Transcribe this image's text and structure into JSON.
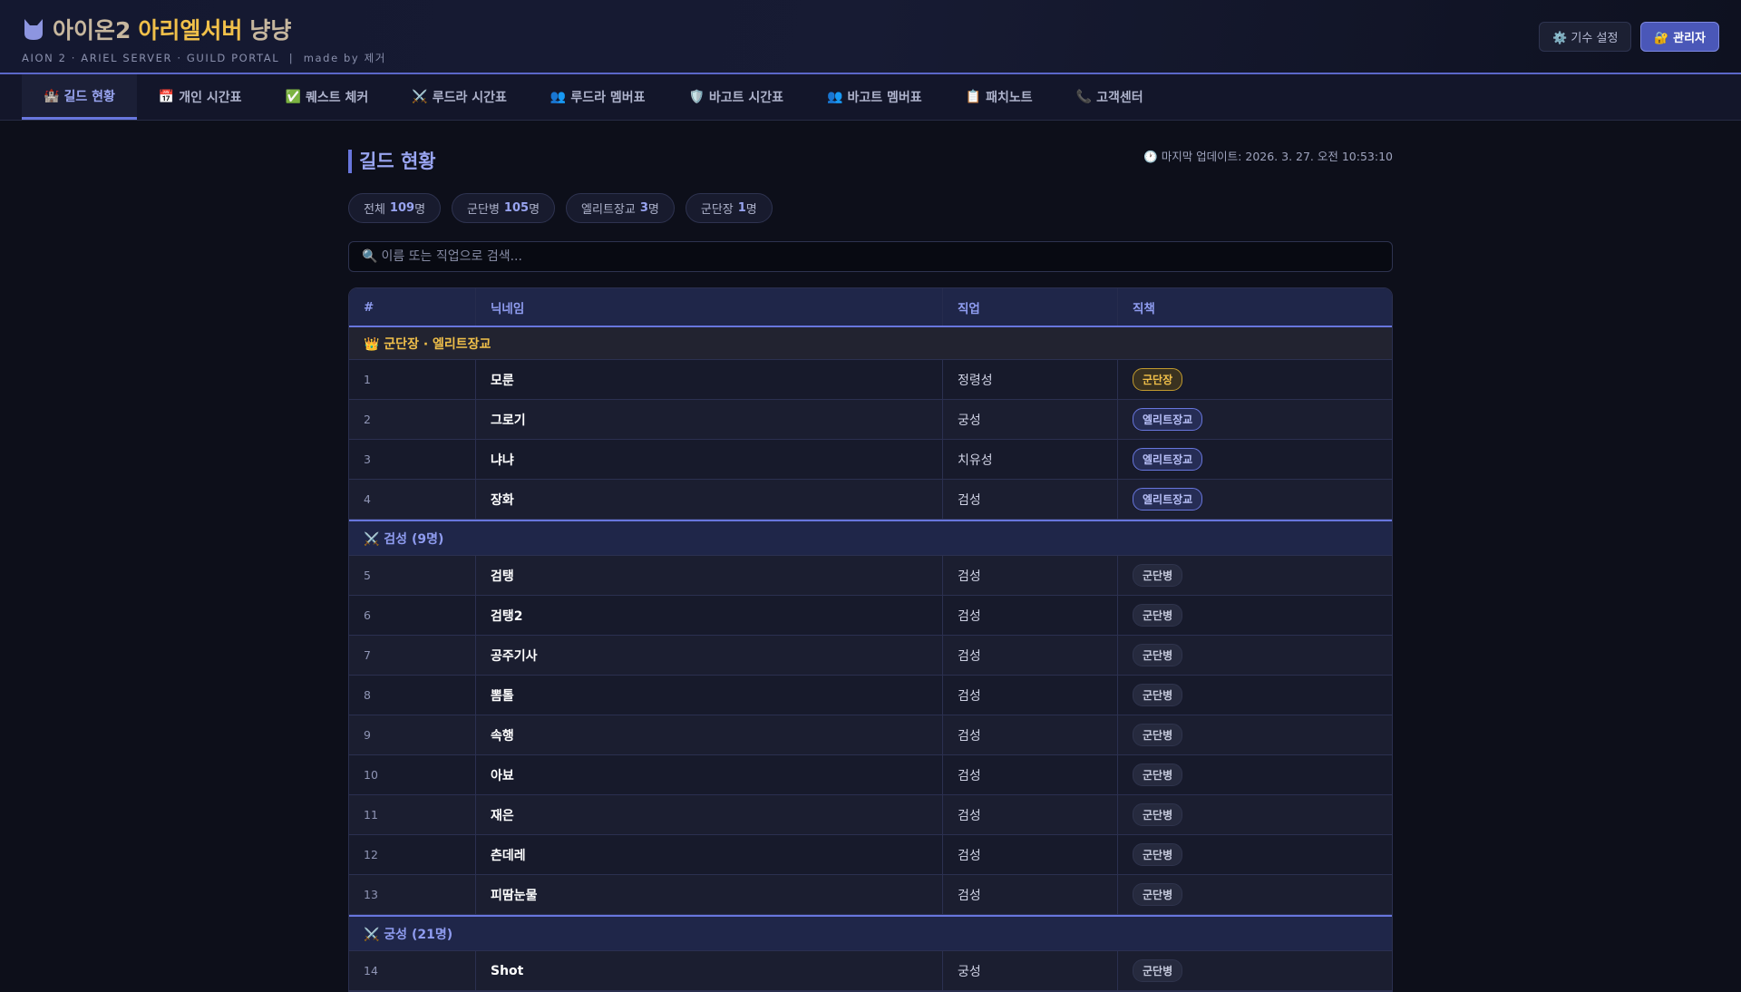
{
  "header": {
    "title_a": "아이온2",
    "title_b": "아리엘서버",
    "title_c": "냥냥",
    "subtitle": "AION 2 · ARIEL SERVER · GUILD PORTAL  |  made by 제거",
    "settings_label": "⚙️ 기수 설정",
    "admin_label": "🔐 관리자"
  },
  "nav": [
    {
      "icon": "🏰",
      "label": "길드 현황"
    },
    {
      "icon": "📅",
      "label": "개인 시간표"
    },
    {
      "icon": "✅",
      "label": "퀘스트 체커"
    },
    {
      "icon": "⚔️",
      "label": "루드라 시간표"
    },
    {
      "icon": "👥",
      "label": "루드라 멤버표"
    },
    {
      "icon": "🛡️",
      "label": "바고트 시간표"
    },
    {
      "icon": "👥",
      "label": "바고트 멤버표"
    },
    {
      "icon": "📋",
      "label": "패치노트"
    },
    {
      "icon": "📞",
      "label": "고객센터"
    }
  ],
  "main": {
    "title": "길드 현황",
    "updated": "🕐 마지막 업데이트: 2026. 3. 27. 오전 10:53:10",
    "stats": [
      {
        "label": "전체",
        "value": "109",
        "unit": "명"
      },
      {
        "label": "군단병",
        "value": "105",
        "unit": "명"
      },
      {
        "label": "엘리트장교",
        "value": "3",
        "unit": "명"
      },
      {
        "label": "군단장",
        "value": "1",
        "unit": "명"
      }
    ],
    "search_placeholder": "이름 또는 직업으로 검색...",
    "columns": [
      "#",
      "닉네임",
      "직업",
      "직책"
    ],
    "groups": [
      {
        "label": "👑 군단장 · 엘리트장교",
        "style": "gold",
        "rows": [
          [
            "1",
            "모룬",
            "정령성",
            "군단장"
          ],
          [
            "2",
            "그로기",
            "궁성",
            "엘리트장교"
          ],
          [
            "3",
            "냐냐",
            "치유성",
            "엘리트장교"
          ],
          [
            "4",
            "장화",
            "검성",
            "엘리트장교"
          ]
        ]
      },
      {
        "label": "⚔️ 검성 (9명)",
        "style": "blue",
        "rows": [
          [
            "5",
            "검탱",
            "검성",
            "군단병"
          ],
          [
            "6",
            "검탱2",
            "검성",
            "군단병"
          ],
          [
            "7",
            "공주기사",
            "검성",
            "군단병"
          ],
          [
            "8",
            "뽐톨",
            "검성",
            "군단병"
          ],
          [
            "9",
            "속행",
            "검성",
            "군단병"
          ],
          [
            "10",
            "아뵤",
            "검성",
            "군단병"
          ],
          [
            "11",
            "재은",
            "검성",
            "군단병"
          ],
          [
            "12",
            "츤데레",
            "검성",
            "군단병"
          ],
          [
            "13",
            "피땀눈물",
            "검성",
            "군단병"
          ]
        ]
      },
      {
        "label": "⚔️ 궁성 (21명)",
        "style": "blue",
        "rows": [
          [
            "14",
            "Shot",
            "궁성",
            "군단병"
          ]
        ]
      }
    ]
  },
  "colors": {
    "accent": "#6876dd",
    "gold": "#f1c04a"
  }
}
